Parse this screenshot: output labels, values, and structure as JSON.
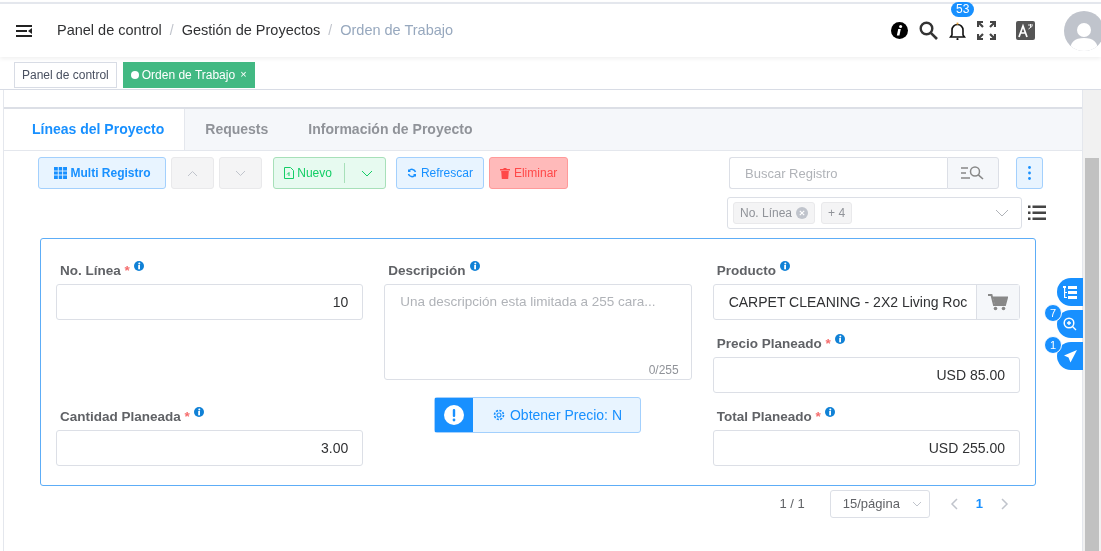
{
  "header": {
    "separator": "/",
    "breadcrumbs": [
      {
        "label": "Panel de control",
        "current": false
      },
      {
        "label": "Gestión de Proyectos",
        "current": false
      },
      {
        "label": "Orden de Trabajo",
        "current": true
      }
    ],
    "notification_count": "53"
  },
  "open_tabs": [
    {
      "label": "Panel de control",
      "selected": false
    },
    {
      "label": "Orden de Trabajo",
      "selected": true,
      "close": "×"
    }
  ],
  "section_tabs": [
    {
      "label": "Líneas del Proyecto",
      "selected": true
    },
    {
      "label": "Requests",
      "selected": false
    },
    {
      "label": "Información de Proyecto",
      "selected": false
    }
  ],
  "toolbar": {
    "buttons": [
      {
        "kind": "multi",
        "label": "Multi Registro"
      },
      {
        "kind": "up",
        "disabled": true
      },
      {
        "kind": "down",
        "disabled": true
      },
      {
        "kind": "new",
        "label": "Nuevo"
      },
      {
        "kind": "refresh",
        "label": "Refrescar"
      },
      {
        "kind": "delete",
        "label": "Eliminar"
      }
    ],
    "search": {
      "placeholder": "Buscar Registro"
    },
    "filter_chips": [
      {
        "label": "No. Línea",
        "removable": true
      },
      {
        "label": "+ 4",
        "removable": false
      }
    ]
  },
  "form": {
    "required_mark": "*",
    "columns": [
      [
        {
          "kind": "input",
          "label": "No. Línea",
          "required": true,
          "value": "10"
        },
        {
          "kind": "input",
          "label": "Cantidad Planeada",
          "required": true,
          "value": "3.00"
        }
      ],
      [
        {
          "kind": "textarea",
          "label": "Descripción",
          "required": false,
          "placeholder": "Una descripción esta limitada a 255 cara...",
          "counter": "0/255"
        },
        {
          "kind": "action",
          "label": "Obtener Precio: N"
        }
      ],
      [
        {
          "kind": "lookup",
          "label": "Producto",
          "required": false,
          "value": "CARPET CLEANING - 2X2 Living Roc"
        },
        {
          "kind": "input",
          "label": "Precio Planeado",
          "required": true,
          "value": "USD 85.00"
        },
        {
          "kind": "input",
          "label": "Total Planeado",
          "required": true,
          "value": "USD 255.00"
        }
      ]
    ]
  },
  "pagination": {
    "summary": "1 / 1",
    "page_size": "15/página",
    "pages": [
      {
        "label": "1",
        "selected": true
      }
    ]
  },
  "side_buttons": [
    {
      "kind": "list"
    },
    {
      "kind": "zoom",
      "badge": "7"
    },
    {
      "kind": "send",
      "badge": "1"
    }
  ]
}
